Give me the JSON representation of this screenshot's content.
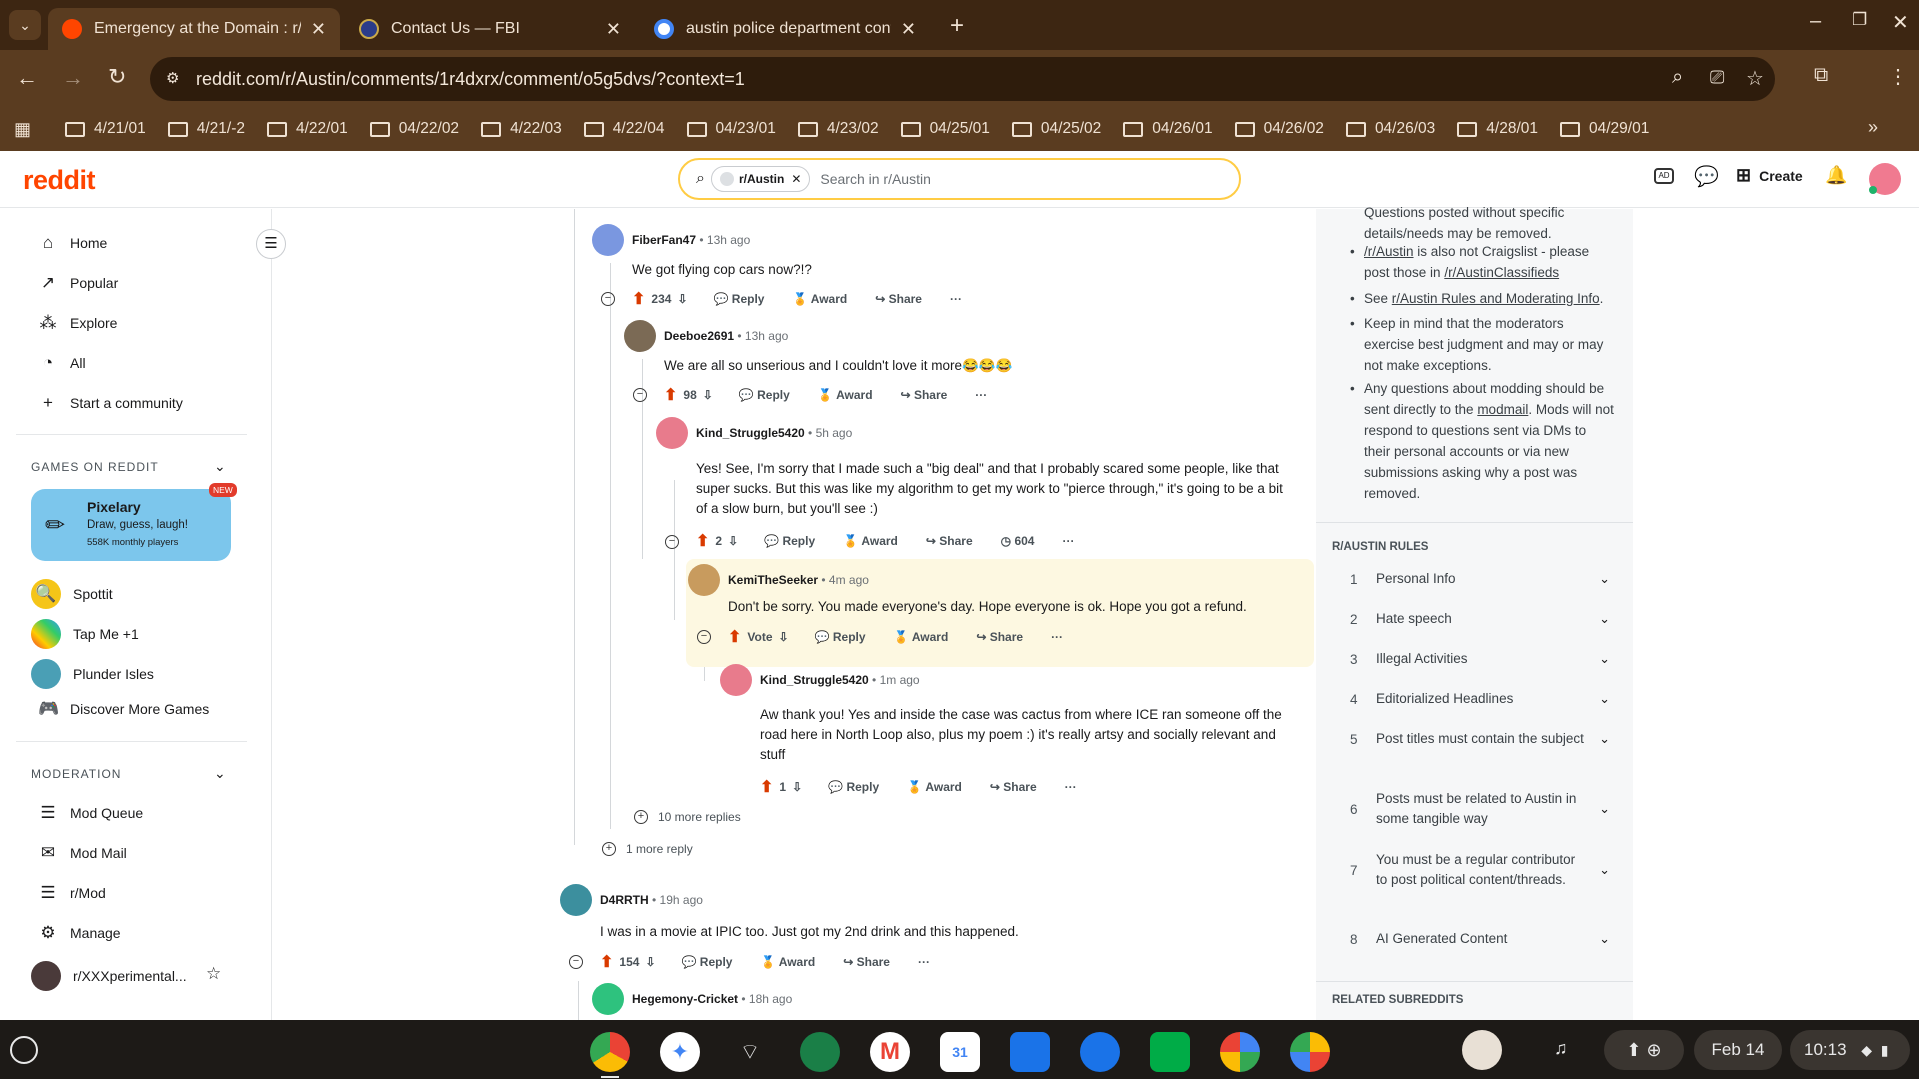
{
  "browser": {
    "tabs": [
      {
        "title": "Emergency at the Domain : r/Au",
        "fav": "#ff4500"
      },
      {
        "title": "Contact Us — FBI",
        "fav": "#2b3c8a"
      },
      {
        "title": "austin police department conta",
        "fav": "#4285f4"
      }
    ],
    "url": "reddit.com/r/Austin/comments/1r4dxrx/comment/o5g5dvs/?context=1",
    "bookmarks": [
      "4/21/01",
      "4/21/-2",
      "4/22/01",
      "04/22/02",
      "4/22/03",
      "4/22/04",
      "04/23/01",
      "4/23/02",
      "04/25/01",
      "04/25/02",
      "04/26/01",
      "04/26/02",
      "04/26/03",
      "4/28/01",
      "04/29/01"
    ]
  },
  "header": {
    "logo": "reddit",
    "chip": "r/Austin",
    "search_placeholder": "Search in r/Austin",
    "create": "Create"
  },
  "nav": {
    "items": [
      "Home",
      "Popular",
      "Explore",
      "All",
      "Start a community"
    ],
    "games_title": "GAMES ON REDDIT",
    "featured": {
      "name": "Pixelary",
      "tagline": "Draw, guess, laugh!",
      "players": "558K monthly players",
      "badge": "NEW"
    },
    "games": [
      "Spottit",
      "Tap Me +1",
      "Plunder Isles",
      "Discover More Games"
    ],
    "moderation_title": "MODERATION",
    "mod": [
      "Mod Queue",
      "Mod Mail",
      "r/Mod",
      "Manage",
      "r/XXXperimental..."
    ]
  },
  "comments": [
    {
      "user": "FiberFan47",
      "ago": "13h ago",
      "text": "We got flying cop cars now?!?",
      "votes": "234"
    },
    {
      "user": "Deeboe2691",
      "ago": "13h ago",
      "text": "We are all so unserious and I couldn't love it more😂😂😂",
      "votes": "98"
    },
    {
      "user": "Kind_Struggle5420",
      "ago": "5h ago",
      "text": "Yes! See, I'm sorry that I made such a \"big deal\" and that I probably scared some people, like that super sucks. But this was like my algorithm to get my work to \"pierce through,\" it's going to be a bit of a slow burn, but you'll see :)",
      "votes": "2",
      "views": "604"
    },
    {
      "user": "KemiTheSeeker",
      "ago": "4m ago",
      "text": "Don't be sorry. You made everyone's day. Hope everyone is ok. Hope you got a refund.",
      "votes": "Vote"
    },
    {
      "user": "Kind_Struggle5420",
      "ago": "1m ago",
      "text": "Aw thank you! Yes and inside the case was cactus from where ICE ran someone off the road here in North Loop also, plus my poem :) it's really artsy and socially relevant and stuff",
      "votes": "1"
    },
    {
      "user": "D4RRTH",
      "ago": "19h ago",
      "text": "I was in a movie at IPIC too. Just got my 2nd drink and this happened.",
      "votes": "154"
    },
    {
      "user": "Hegemony-Cricket",
      "ago": "18h ago"
    }
  ],
  "actions": {
    "reply": "Reply",
    "award": "Award",
    "share": "Share",
    "more_replies_10": "10 more replies",
    "more_replies_1": "1 more reply"
  },
  "sidebar": {
    "text_top": "Questions posted without specific details/needs may be removed.",
    "bullets": [
      {
        "a": "/r/Austin",
        "b": " is also not Craigslist - please post those in ",
        "c": "/r/AustinClassifieds"
      },
      {
        "a": "See ",
        "b": "r/Austin Rules and Moderating Info",
        "c": "."
      },
      {
        "a": "Keep in mind that the moderators exercise best judgment and may or may not make exceptions."
      },
      {
        "a": "Any questions about modding should be sent directly to the ",
        "b": "modmail",
        "c": ". Mods will not respond to questions sent via DMs to their personal accounts or via new submissions asking why a post was removed."
      }
    ],
    "rules_title": "R/AUSTIN RULES",
    "rules": [
      "Personal Info",
      "Hate speech",
      "Illegal Activities",
      "Editorialized Headlines",
      "Post titles must contain the subject",
      "Posts must be related to Austin in some tangible way",
      "You must be a regular contributor to post political content/threads.",
      "AI Generated Content"
    ],
    "related_title": "RELATED SUBREDDITS"
  },
  "taskbar": {
    "date": "Feb 14",
    "time": "10:13"
  }
}
